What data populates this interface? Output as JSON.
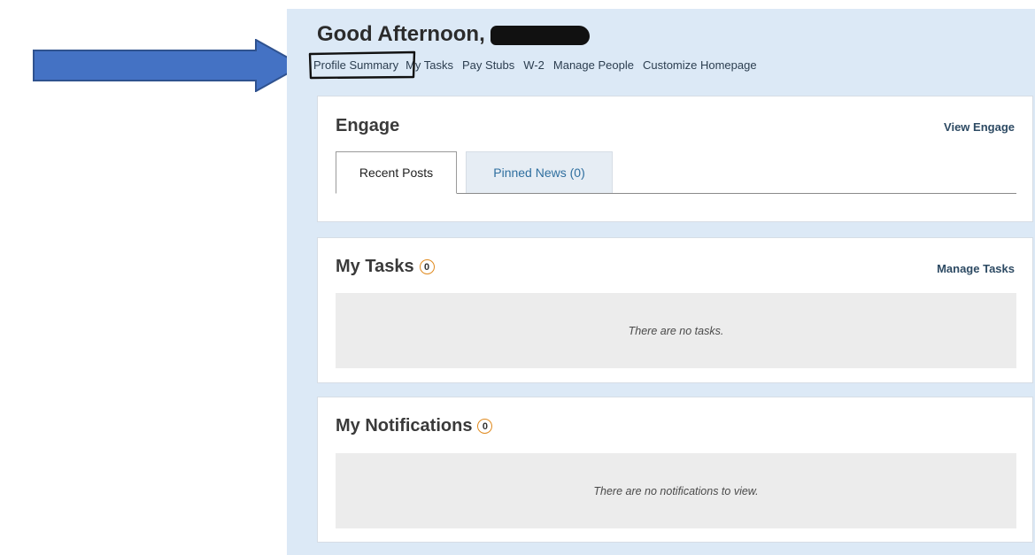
{
  "header": {
    "greeting": "Good Afternoon,"
  },
  "nav": {
    "items": [
      {
        "label": "Profile Summary"
      },
      {
        "label": "My Tasks"
      },
      {
        "label": "Pay Stubs"
      },
      {
        "label": "W-2"
      },
      {
        "label": "Manage People"
      },
      {
        "label": "Customize Homepage"
      }
    ]
  },
  "engage": {
    "title": "Engage",
    "link": "View Engage",
    "tabs": [
      {
        "label": "Recent Posts",
        "active": true
      },
      {
        "label": "Pinned News (0)",
        "active": false
      }
    ]
  },
  "tasks": {
    "title": "My Tasks",
    "count": "0",
    "link": "Manage Tasks",
    "empty_text": "There are no tasks."
  },
  "notifications": {
    "title": "My Notifications",
    "count": "0",
    "empty_text": "There are no notifications to view."
  },
  "colors": {
    "panel_bg": "#dce9f6",
    "arrow_fill": "#4472c4",
    "arrow_stroke": "#2f528f",
    "badge_ring": "#e08a1e",
    "link": "#2d4a63",
    "tab_inactive_text": "#2f6f9f"
  },
  "annotations": {
    "arrow_icon": "right-arrow-icon",
    "circle_mark": "hand-drawn-circle"
  }
}
